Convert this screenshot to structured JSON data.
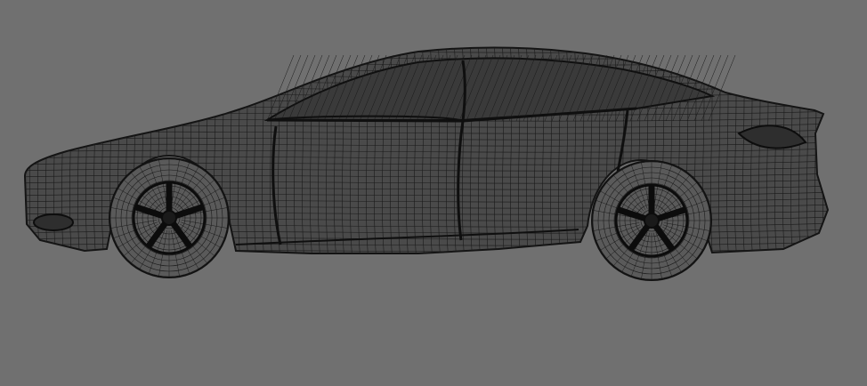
{
  "viewport": {
    "background": "#707070",
    "wire_color": "#1a1a1a",
    "subject": "car-wireframe-side-view"
  }
}
